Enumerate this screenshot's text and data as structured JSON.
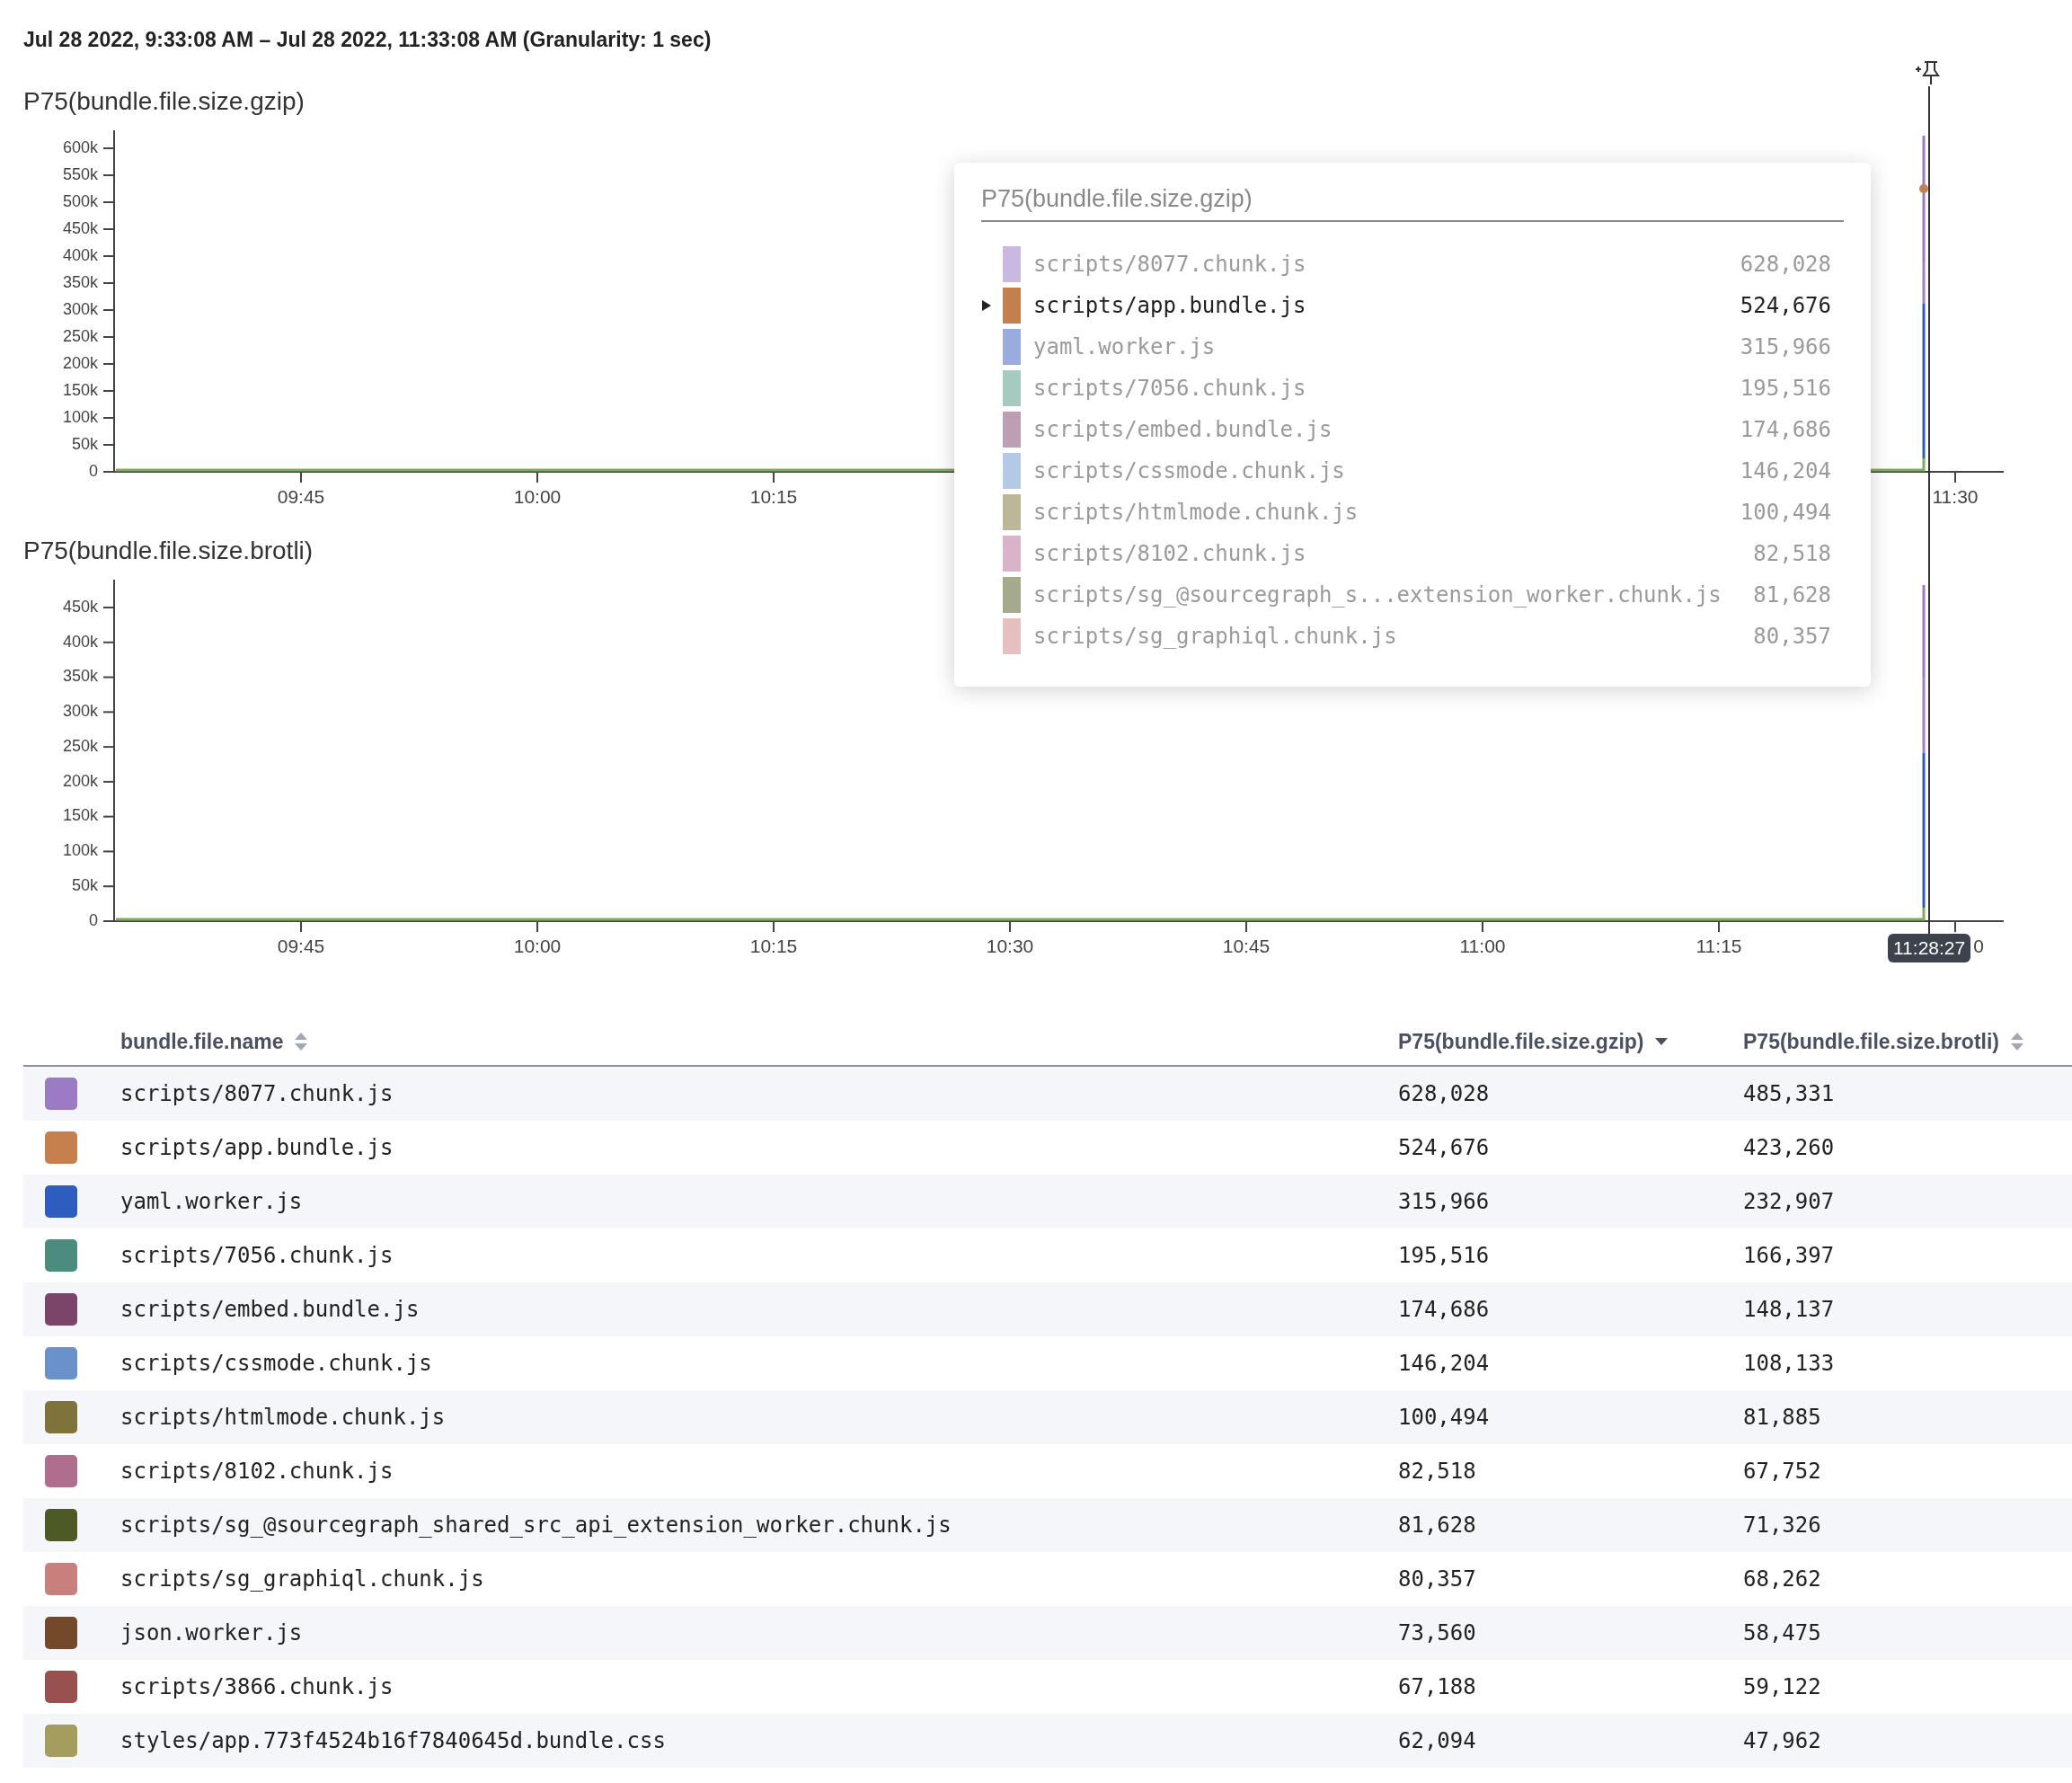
{
  "range_header": "Jul 28 2022, 9:33:08 AM – Jul 28 2022, 11:33:08 AM (Granularity: 1 sec)",
  "charts": [
    {
      "title": "P75(bundle.file.size.gzip)",
      "hover_point": true,
      "y_ticks": [
        "600k",
        "550k",
        "500k",
        "450k",
        "400k",
        "350k",
        "300k",
        "250k",
        "200k",
        "150k",
        "100k",
        "50k",
        "0"
      ],
      "x_ticks": [
        "09:45",
        "10:00",
        "10:15",
        "11:30"
      ]
    },
    {
      "title": "P75(bundle.file.size.brotli)",
      "y_ticks": [
        "450k",
        "400k",
        "350k",
        "300k",
        "250k",
        "200k",
        "150k",
        "100k",
        "50k",
        "0"
      ],
      "x_ticks": [
        "09:45",
        "10:00",
        "10:15",
        "10:30",
        "10:45",
        "11:00",
        "11:15",
        "0"
      ]
    }
  ],
  "cursor_time": "11:28:27",
  "tooltip": {
    "title": "P75(bundle.file.size.gzip)",
    "items": [
      {
        "name": "scripts/8077.chunk.js",
        "value": "628,028",
        "color": "#c9b8e0",
        "selected": false
      },
      {
        "name": "scripts/app.bundle.js",
        "value": "524,676",
        "color": "#c47f4e",
        "selected": true
      },
      {
        "name": "yaml.worker.js",
        "value": "315,966",
        "color": "#98acdf",
        "selected": false
      },
      {
        "name": "scripts/7056.chunk.js",
        "value": "195,516",
        "color": "#a6c9c0",
        "selected": false
      },
      {
        "name": "scripts/embed.bundle.js",
        "value": "174,686",
        "color": "#bd9fb3",
        "selected": false
      },
      {
        "name": "scripts/cssmode.chunk.js",
        "value": "146,204",
        "color": "#b3c9e6",
        "selected": false
      },
      {
        "name": "scripts/htmlmode.chunk.js",
        "value": "100,494",
        "color": "#bdb79a",
        "selected": false
      },
      {
        "name": "scripts/8102.chunk.js",
        "value": "82,518",
        "color": "#d9b4c8",
        "selected": false
      },
      {
        "name": "scripts/sg_@sourcegraph_s...extension_worker.chunk.js",
        "value": "81,628",
        "color": "#a6aa8c",
        "selected": false
      },
      {
        "name": "scripts/sg_graphiql.chunk.js",
        "value": "80,357",
        "color": "#e6c0c0",
        "selected": false
      }
    ]
  },
  "table": {
    "columns": [
      {
        "label": "bundle.file.name",
        "sorted_descending": false
      },
      {
        "label": "P75(bundle.file.size.gzip)",
        "sorted_descending": true
      },
      {
        "label": "P75(bundle.file.size.brotli)",
        "sorted_descending": false
      }
    ],
    "rows": [
      {
        "color": "#9b7bc3",
        "cells": [
          "scripts/8077.chunk.js",
          "628,028",
          "485,331"
        ]
      },
      {
        "color": "#c6804e",
        "cells": [
          "scripts/app.bundle.js",
          "524,676",
          "423,260"
        ]
      },
      {
        "color": "#2f5cbf",
        "cells": [
          "yaml.worker.js",
          "315,966",
          "232,907"
        ]
      },
      {
        "color": "#4b8c7f",
        "cells": [
          "scripts/7056.chunk.js",
          "195,516",
          "166,397"
        ]
      },
      {
        "color": "#7b4469",
        "cells": [
          "scripts/embed.bundle.js",
          "174,686",
          "148,137"
        ]
      },
      {
        "color": "#6892c9",
        "cells": [
          "scripts/cssmode.chunk.js",
          "146,204",
          "108,133"
        ]
      },
      {
        "color": "#7d733b",
        "cells": [
          "scripts/htmlmode.chunk.js",
          "100,494",
          "81,885"
        ]
      },
      {
        "color": "#b06e8e",
        "cells": [
          "scripts/8102.chunk.js",
          "82,518",
          "67,752"
        ]
      },
      {
        "color": "#4e5a25",
        "cells": [
          "scripts/sg_@sourcegraph_shared_src_api_extension_worker.chunk.js",
          "81,628",
          "71,326"
        ]
      },
      {
        "color": "#c97f7c",
        "cells": [
          "scripts/sg_graphiql.chunk.js",
          "80,357",
          "68,262"
        ]
      },
      {
        "color": "#74482a",
        "cells": [
          "json.worker.js",
          "73,560",
          "58,475"
        ]
      },
      {
        "color": "#99514f",
        "cells": [
          "scripts/3866.chunk.js",
          "67,188",
          "59,122"
        ]
      },
      {
        "color": "#a59d5d",
        "cells": [
          "styles/app.773f4524b16f7840645d.bundle.css",
          "62,094",
          "47,962"
        ]
      }
    ]
  }
}
